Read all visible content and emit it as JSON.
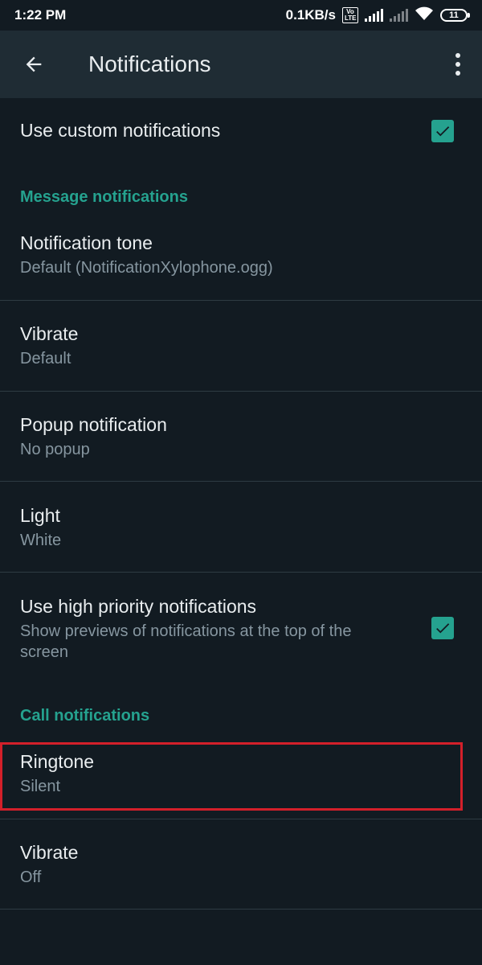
{
  "status_bar": {
    "time": "1:22 PM",
    "net_speed": "0.1KB/s",
    "volte": "Vo LTE",
    "battery": "11",
    "icons": [
      "signal-icon",
      "signal-no-service-icon",
      "wifi-icon",
      "battery-icon"
    ]
  },
  "app_bar": {
    "title": "Notifications",
    "back_icon": "arrow-back-icon",
    "menu_icon": "more-vert-icon"
  },
  "settings": {
    "custom": {
      "label": "Use custom notifications",
      "checked": true
    },
    "message_section": "Message notifications",
    "tone": {
      "label": "Notification tone",
      "value": "Default (NotificationXylophone.ogg)"
    },
    "vibrate": {
      "label": "Vibrate",
      "value": "Default"
    },
    "popup": {
      "label": "Popup notification",
      "value": "No popup"
    },
    "light": {
      "label": "Light",
      "value": "White"
    },
    "high_priority": {
      "label": "Use high priority notifications",
      "value": "Show previews of notifications at the top of the screen",
      "checked": true
    },
    "call_section": "Call notifications",
    "ringtone": {
      "label": "Ringtone",
      "value": "Silent"
    },
    "call_vibrate": {
      "label": "Vibrate",
      "value": "Off"
    }
  },
  "colors": {
    "background": "#121b22",
    "app_bar": "#1f2c34",
    "accent": "#25a28f",
    "highlight": "#d3202a"
  }
}
